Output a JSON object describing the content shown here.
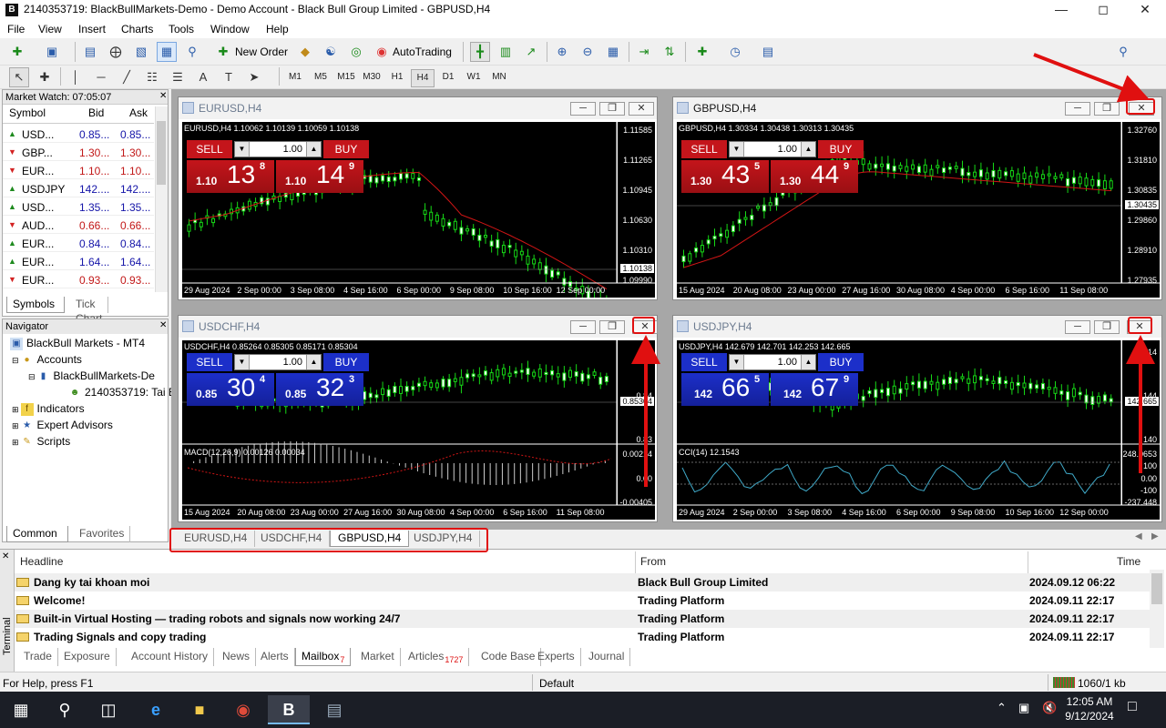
{
  "window": {
    "title": "2140353719: BlackBullMarkets-Demo - Demo Account - Black Bull Group Limited - GBPUSD,H4"
  },
  "menu": [
    "File",
    "View",
    "Insert",
    "Charts",
    "Tools",
    "Window",
    "Help"
  ],
  "toolbar": {
    "new_order": "New Order",
    "autotrading": "AutoTrading",
    "notify_count": "1"
  },
  "timeframes": [
    "M1",
    "M5",
    "M15",
    "M30",
    "H1",
    "H4",
    "D1",
    "W1",
    "MN"
  ],
  "active_timeframe": "H4",
  "market_watch": {
    "title": "Market Watch: 07:05:07",
    "columns": [
      "Symbol",
      "Bid",
      "Ask"
    ],
    "rows": [
      {
        "symbol": "USD...",
        "bid": "0.85...",
        "ask": "0.85...",
        "dir": "up"
      },
      {
        "symbol": "GBP...",
        "bid": "1.30...",
        "ask": "1.30...",
        "dir": "down"
      },
      {
        "symbol": "EUR...",
        "bid": "1.10...",
        "ask": "1.10...",
        "dir": "down"
      },
      {
        "symbol": "USDJPY",
        "bid": "142....",
        "ask": "142....",
        "dir": "up"
      },
      {
        "symbol": "USD...",
        "bid": "1.35...",
        "ask": "1.35...",
        "dir": "up"
      },
      {
        "symbol": "AUD...",
        "bid": "0.66...",
        "ask": "0.66...",
        "dir": "down"
      },
      {
        "symbol": "EUR...",
        "bid": "0.84...",
        "ask": "0.84...",
        "dir": "up"
      },
      {
        "symbol": "EUR...",
        "bid": "1.64...",
        "ask": "1.64...",
        "dir": "up"
      },
      {
        "symbol": "EUR...",
        "bid": "0.93...",
        "ask": "0.93...",
        "dir": "down"
      }
    ],
    "tabs": [
      "Symbols",
      "Tick Chart"
    ]
  },
  "navigator": {
    "title": "Navigator",
    "items": [
      "BlackBull Markets - MT4",
      "Accounts",
      "BlackBullMarkets-De",
      "2140353719: Tai E",
      "Indicators",
      "Expert Advisors",
      "Scripts"
    ],
    "tabs": [
      "Common",
      "Favorites"
    ]
  },
  "charts": [
    {
      "id": "eurusd",
      "title": "EURUSD,H4",
      "info": "EURUSD,H4  1.10062 1.10139 1.10059 1.10138",
      "sell_pre": "1.10",
      "sell_big": "13",
      "sell_sup": "8",
      "buy_pre": "1.10",
      "buy_big": "14",
      "buy_sup": "9",
      "lot": "1.00",
      "sell": "SELL",
      "buy": "BUY",
      "theme": "red",
      "y_ticks": [
        "1.11585",
        "1.11265",
        "1.10945",
        "1.10630",
        "1.10310",
        "1.09990"
      ],
      "price_tag": "1.10138",
      "x_ticks": [
        "29 Aug 2024",
        "2 Sep 00:00",
        "3 Sep 08:00",
        "4 Sep 16:00",
        "6 Sep 00:00",
        "9 Sep 08:00",
        "10 Sep 16:00",
        "12 Sep 00:00"
      ]
    },
    {
      "id": "gbpusd",
      "title": "GBPUSD,H4",
      "info": "GBPUSD,H4  1.30334 1.30438 1.30313 1.30435",
      "sell_pre": "1.30",
      "sell_big": "43",
      "sell_sup": "5",
      "buy_pre": "1.30",
      "buy_big": "44",
      "buy_sup": "9",
      "lot": "1.00",
      "sell": "SELL",
      "buy": "BUY",
      "theme": "red",
      "y_ticks": [
        "1.32760",
        "1.31810",
        "1.30835",
        "1.29860",
        "1.28910",
        "1.27935"
      ],
      "price_tag": "1.30435",
      "x_ticks": [
        "15 Aug 2024",
        "20 Aug 08:00",
        "23 Aug 00:00",
        "27 Aug 16:00",
        "30 Aug 08:00",
        "4 Sep 00:00",
        "6 Sep 16:00",
        "11 Sep 08:00"
      ]
    },
    {
      "id": "usdchf",
      "title": "USDCHF,H4",
      "info": "USDCHF,H4  0.85264 0.85305 0.85171 0.85304",
      "sell_pre": "0.85",
      "sell_big": "30",
      "sell_sup": "4",
      "buy_pre": "0.85",
      "buy_big": "32",
      "buy_sup": "3",
      "lot": "1.00",
      "sell": "SELL",
      "buy": "BUY",
      "theme": "blue",
      "y_ticks": [
        "0.8",
        "0.84",
        "0.83"
      ],
      "price_tag": "0.85304",
      "ind_info": "MACD(12,26,9) 0.00126 0.00034",
      "ind_ticks": [
        "0.00214",
        "0.00",
        "-0.00405"
      ],
      "x_ticks": [
        "15 Aug 2024",
        "20 Aug 08:00",
        "23 Aug 00:00",
        "27 Aug 16:00",
        "30 Aug 08:00",
        "4 Sep 00:00",
        "6 Sep 16:00",
        "11 Sep 08:00"
      ]
    },
    {
      "id": "usdjpy",
      "title": "USDJPY,H4",
      "info": "USDJPY,H4  142.679 142.701 142.253 142.665",
      "sell_pre": "142",
      "sell_big": "66",
      "sell_sup": "5",
      "buy_pre": "142",
      "buy_big": "67",
      "buy_sup": "9",
      "lot": "1.00",
      "sell": "SELL",
      "buy": "BUY",
      "theme": "blue",
      "y_ticks": [
        "14",
        "144",
        "140"
      ],
      "price_tag": "142.665",
      "ind_info": "CCI(14) 12.1543",
      "ind_ticks": [
        "248.0653",
        "100",
        "0.00",
        "-100",
        "-237.448"
      ],
      "x_ticks": [
        "29 Aug 2024",
        "2 Sep 00:00",
        "3 Sep 08:00",
        "4 Sep 16:00",
        "6 Sep 00:00",
        "9 Sep 08:00",
        "10 Sep 16:00",
        "12 Sep 00:00"
      ]
    }
  ],
  "chart_tabs": [
    "EURUSD,H4",
    "USDCHF,H4",
    "GBPUSD,H4",
    "USDJPY,H4"
  ],
  "active_chart_tab": "GBPUSD,H4",
  "terminal": {
    "side_label": "Terminal",
    "columns": [
      "Headline",
      "From",
      "Time"
    ],
    "rows": [
      {
        "headline": "Dang ky tai khoan moi",
        "from": "Black Bull Group Limited",
        "time": "2024.09.12 06:22"
      },
      {
        "headline": "Welcome!",
        "from": "Trading Platform",
        "time": "2024.09.11 22:17"
      },
      {
        "headline": "Built-in Virtual Hosting — trading robots and signals now working 24/7",
        "from": "Trading Platform",
        "time": "2024.09.11 22:17"
      },
      {
        "headline": "Trading Signals and copy trading",
        "from": "Trading Platform",
        "time": "2024.09.11 22:17"
      }
    ],
    "tabs": [
      {
        "label": "Trade"
      },
      {
        "label": "Exposure"
      },
      {
        "label": "Account History"
      },
      {
        "label": "News"
      },
      {
        "label": "Alerts"
      },
      {
        "label": "Mailbox",
        "badge": "7"
      },
      {
        "label": "Market"
      },
      {
        "label": "Articles",
        "badge": "1727"
      },
      {
        "label": "Code Base"
      },
      {
        "label": "Experts"
      },
      {
        "label": "Journal"
      }
    ],
    "active_tab": "Mailbox"
  },
  "status": {
    "help": "For Help, press F1",
    "profile": "Default",
    "traffic": "1060/1 kb"
  },
  "taskbar": {
    "time": "12:05 AM",
    "date": "9/12/2024"
  },
  "colors": {
    "sell_red": "#c4151b",
    "buy_red": "#c4151b",
    "sell_blue": "#1c2fc9",
    "annotation": "#e01010",
    "candle": "#16d916",
    "ma": "#d11515"
  }
}
